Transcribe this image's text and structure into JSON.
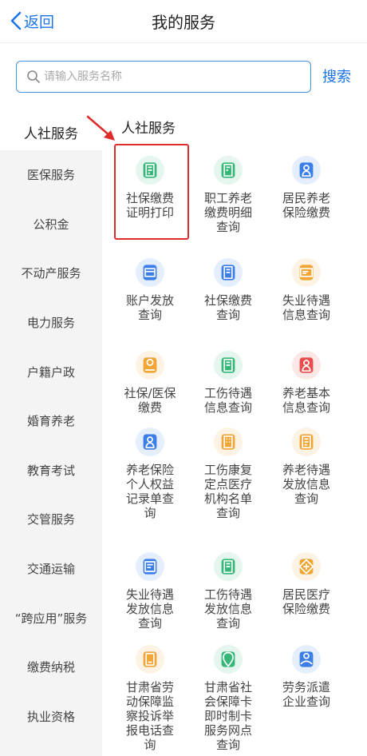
{
  "header": {
    "back_label": "返回",
    "title": "我的服务"
  },
  "search": {
    "placeholder": "请输入服务名称",
    "button_label": "搜索"
  },
  "sidebar": {
    "selected_label": "人社服务",
    "items": [
      "医保服务",
      "公积金",
      "不动产服务",
      "电力服务",
      "户籍户政",
      "婚育养老",
      "教育考试",
      "交管服务",
      "交通运输",
      "“跨应用”服务",
      "缴费纳税",
      "执业资格"
    ]
  },
  "section": {
    "title": "人社服务"
  },
  "services": [
    {
      "label": "社保缴费证明打印",
      "icon": "document-star-icon",
      "color": "#35b877"
    },
    {
      "label": "职工养老缴费明细查询",
      "icon": "document-money-icon",
      "color": "#35b877"
    },
    {
      "label": "居民养老保险缴费",
      "icon": "elder-person-icon",
      "color": "#3b7ee8"
    },
    {
      "label": "账户发放查询",
      "icon": "bank-card-search-icon",
      "color": "#3b7ee8"
    },
    {
      "label": "社保缴费查询",
      "icon": "document-search-icon",
      "color": "#3b7ee8"
    },
    {
      "label": "失业待遇信息查询",
      "icon": "card-search-icon",
      "color": "#f0a534"
    },
    {
      "label": "社保/医保缴费",
      "icon": "hand-coin-icon",
      "color": "#f0a534"
    },
    {
      "label": "工伤待遇信息查询",
      "icon": "document-yen-search-icon",
      "color": "#35b877"
    },
    {
      "label": "养老基本信息查询",
      "icon": "elder-search-icon",
      "color": "#e84c4c"
    },
    {
      "label": "养老保险个人权益记录单查询",
      "icon": "elder-person-icon",
      "color": "#3b7ee8"
    },
    {
      "label": "工伤康复定点医疗机构名单查询",
      "icon": "building-icon",
      "color": "#f0a534"
    },
    {
      "label": "养老待遇发放信息查询",
      "icon": "document-edit-icon",
      "color": "#f0a534"
    },
    {
      "label": "失业待遇发放信息查询",
      "icon": "list-search-icon",
      "color": "#3b7ee8"
    },
    {
      "label": "工伤待遇发放信息查询",
      "icon": "document-yen-search-icon",
      "color": "#35b877"
    },
    {
      "label": "居民医疗保险缴费",
      "icon": "medical-diamond-icon",
      "color": "#f0a534"
    },
    {
      "label": "甘肃省劳动保障监察投诉举报电话查询",
      "icon": "phone-icon",
      "color": "#f0a534"
    },
    {
      "label": "甘肃省社会保障卡即时制卡服务网点查询",
      "icon": "map-pin-icon",
      "color": "#35b877"
    },
    {
      "label": "劳务派遣企业查询",
      "icon": "hand-person-icon",
      "color": "#3b7ee8"
    }
  ],
  "colors": {
    "accent": "#1a73e8",
    "highlight": "#e02b2b"
  }
}
